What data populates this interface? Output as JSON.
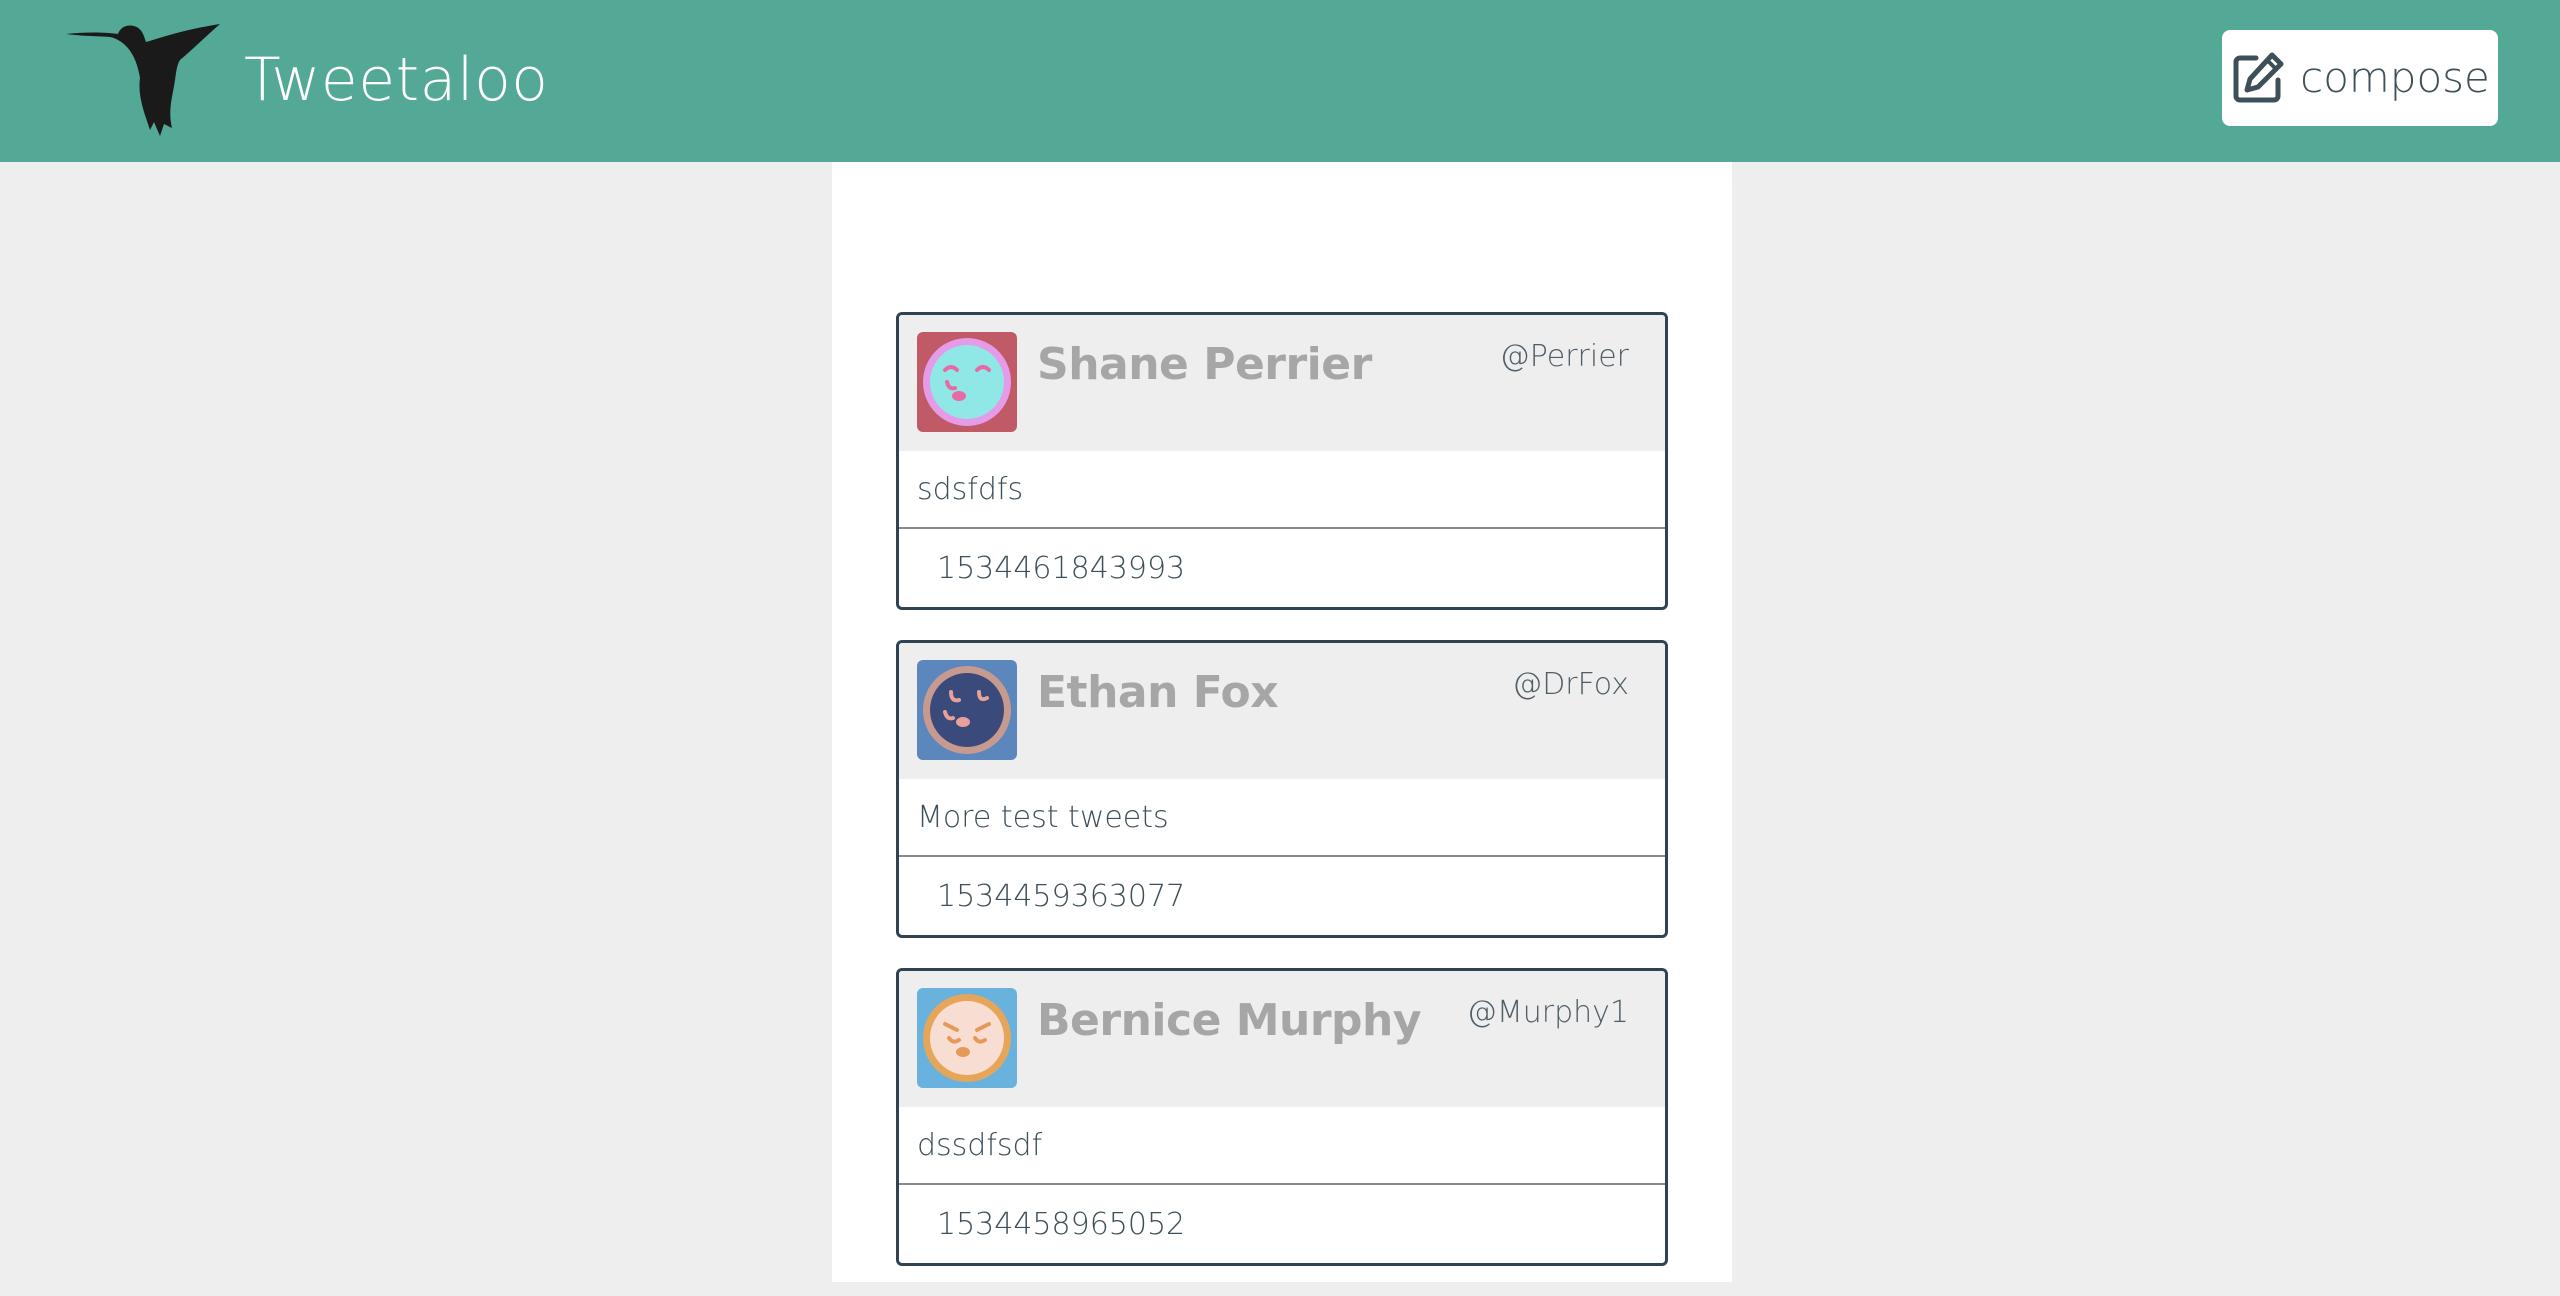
{
  "header": {
    "title": "Tweetaloo",
    "compose_label": "compose",
    "colors": {
      "background": "#53a896",
      "title": "#ffffff"
    },
    "logo_icon": "hummingbird-icon",
    "compose_icon": "edit-icon"
  },
  "tweets": [
    {
      "name": "Shane Perrier",
      "handle": "@Perrier",
      "text": "sdsfdfs",
      "timestamp": "1534461843993",
      "avatar": {
        "icon": "face-avatar-icon",
        "bg": "#c05a66",
        "ring": "#e59be8",
        "face": "#8fe8e6",
        "features": "#e86aa4"
      }
    },
    {
      "name": "Ethan Fox",
      "handle": "@DrFox",
      "text": "More test tweets",
      "timestamp": "1534459363077",
      "avatar": {
        "icon": "face-avatar-icon",
        "bg": "#5b87bd",
        "ring": "#c79a8f",
        "face": "#3a4a7a",
        "features": "#e8a09a"
      }
    },
    {
      "name": "Bernice Murphy",
      "handle": "@Murphy1",
      "text": "dssdfsdf",
      "timestamp": "1534458965052",
      "avatar": {
        "icon": "face-avatar-icon",
        "bg": "#69b2de",
        "ring": "#e6a65a",
        "face": "#f8ddd2",
        "features": "#e69a5a"
      }
    }
  ]
}
